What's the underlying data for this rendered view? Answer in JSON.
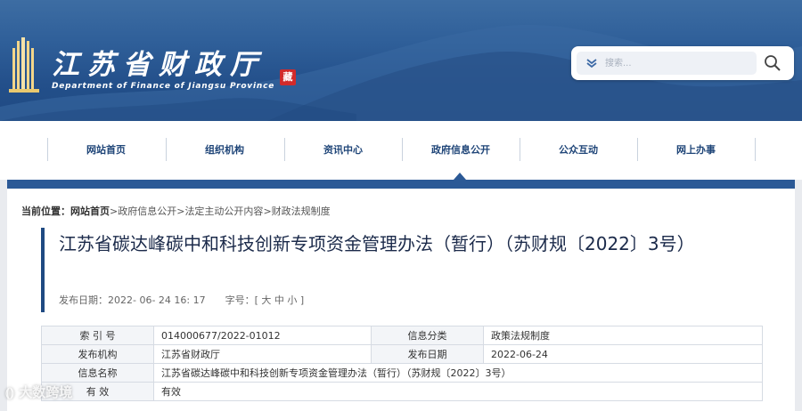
{
  "header": {
    "site_title": "江苏省财政厅",
    "site_subtitle": "Department of Finance of Jiangsu Province",
    "seal_text": "藏",
    "search": {
      "placeholder": "搜索...",
      "dropdown_icon": "chevron-double-down-icon",
      "button_icon": "search-icon"
    }
  },
  "nav": {
    "items": [
      {
        "label": "网站首页"
      },
      {
        "label": "组织机构"
      },
      {
        "label": "资讯中心"
      },
      {
        "label": "政府信息公开"
      },
      {
        "label": "公众互动"
      },
      {
        "label": "网上办事"
      }
    ],
    "active_index": 3
  },
  "breadcrumb": {
    "label": "当前位置：",
    "home": "网站首页",
    "separator": ">",
    "crumbs": [
      "政府信息公开",
      "法定主动公开内容",
      "财政法规制度"
    ]
  },
  "article": {
    "title": "江苏省碳达峰碳中和科技创新专项资金管理办法（暂行）（苏财规〔2022〕3号）",
    "publish_label": "发布日期：",
    "publish_date": "2022- 06- 24   16: 17",
    "fontsize_label": "字号：",
    "fontsize_open": "[",
    "fontsize_large": "大",
    "fontsize_medium": "中",
    "fontsize_small": "小",
    "fontsize_close": "]"
  },
  "info_table": {
    "rows": [
      {
        "k1": "索 引 号",
        "v1": "014000677/2022-01012",
        "k2": "信息分类",
        "v2": "政策法规制度"
      },
      {
        "k1": "发布机构",
        "v1": "江苏省财政厅",
        "k2": "发布日期",
        "v2": "2022-06-24"
      },
      {
        "k1": "信息名称",
        "v1": "江苏省碳达峰碳中和科技创新专项资金管理办法（暂行）（苏财规〔2022〕3号）"
      },
      {
        "k1": "有 效",
        "v1": "有效"
      }
    ]
  },
  "watermark": {
    "text": "大数跨境"
  },
  "colors": {
    "banner": "#2f5f99",
    "nav_bar": "#2b5996",
    "nav_text": "#1f4578",
    "title_accent": "#1f4a82",
    "seal": "#d22a2a"
  }
}
